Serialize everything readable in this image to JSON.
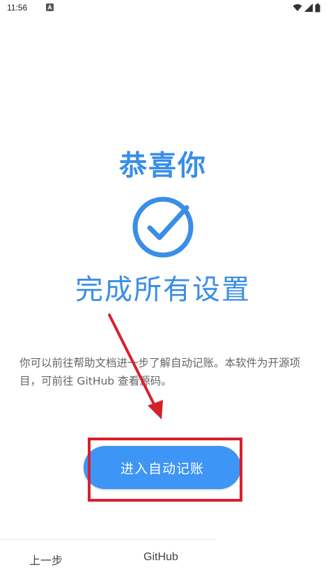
{
  "status_bar": {
    "time": "11:56",
    "icons": [
      "notification-a-icon",
      "wifi-icon",
      "signal-icon",
      "battery-icon"
    ]
  },
  "main": {
    "title": "恭喜你",
    "check_icon": "check-circle-icon",
    "subtitle": "完成所有设置",
    "description": "你可以前往帮助文档进一步了解自动记账。本软件为开源项目，可前往 GitHub 查看源码。",
    "primary_button_label": "进入自动记账"
  },
  "bottom_bar": {
    "prev_label": "上一步",
    "github_label": "GitHub"
  },
  "colors": {
    "accent": "#3a8ee6",
    "button": "#3d95f6",
    "annotation": "#d7202d"
  }
}
